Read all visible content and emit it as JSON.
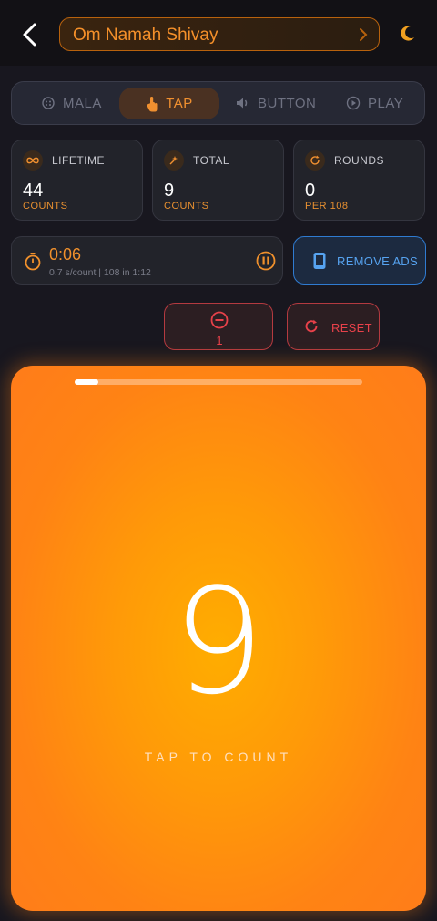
{
  "header": {
    "title": "Om Namah Shivay"
  },
  "modes": [
    {
      "label": "MALA",
      "icon": "mala-icon"
    },
    {
      "label": "TAP",
      "icon": "tap-hand-icon",
      "active": true
    },
    {
      "label": "BUTTON",
      "icon": "speaker-icon"
    },
    {
      "label": "PLAY",
      "icon": "play-icon"
    }
  ],
  "stats": [
    {
      "label": "LIFETIME",
      "value": "44",
      "sub": "COUNTS",
      "icon": "infinity-icon"
    },
    {
      "label": "TOTAL",
      "value": "9",
      "sub": "COUNTS",
      "icon": "sparkle-icon"
    },
    {
      "label": "ROUNDS",
      "value": "0",
      "sub": "PER 108",
      "icon": "refresh-icon"
    }
  ],
  "timer": {
    "elapsed": "0:06",
    "details": "0.7 s/count  |  108 in 1:12"
  },
  "ads": {
    "label": "REMOVE ADS"
  },
  "decrement": {
    "count": "1"
  },
  "reset": {
    "label": "RESET"
  },
  "counter": {
    "value": "9",
    "hint": "TAP TO COUNT",
    "progress": 0.083
  },
  "colors": {
    "accent": "#f0902c",
    "danger": "#e8414a",
    "info": "#56a3f0",
    "tap_bg": "#ff8c10"
  }
}
